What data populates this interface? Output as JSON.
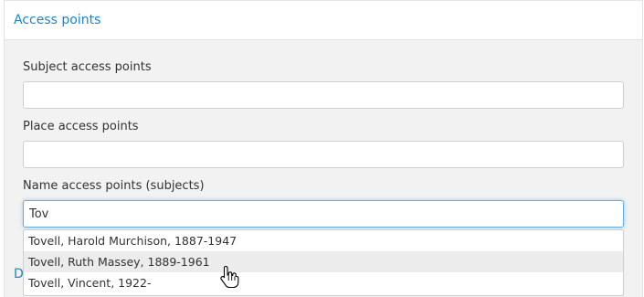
{
  "section": {
    "title": "Access points",
    "next_section_partial": "D"
  },
  "fields": {
    "subject": {
      "label": "Subject access points",
      "value": ""
    },
    "place": {
      "label": "Place access points",
      "value": ""
    },
    "name": {
      "label": "Name access points (subjects)",
      "value": "Tov"
    }
  },
  "autocomplete": {
    "items": [
      "Tovell, Harold Murchison, 1887-1947",
      "Tovell, Ruth Massey, 1889-1961",
      "Tovell, Vincent, 1922-"
    ],
    "hovered_index": 1
  },
  "colors": {
    "link": "#1b86c4",
    "panel_bg": "#f2f2f2",
    "focus_border": "#66afe9"
  },
  "icons": {
    "mouse_pointer": "hand-pointer-icon"
  }
}
